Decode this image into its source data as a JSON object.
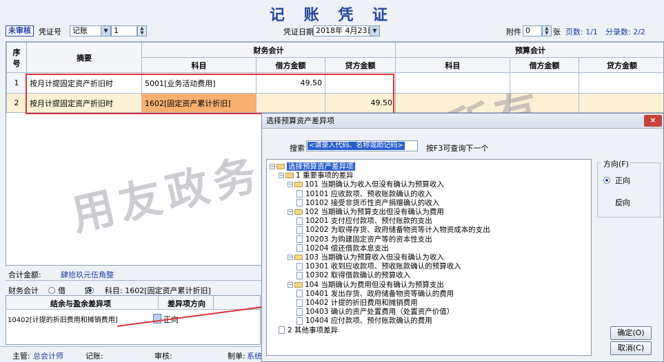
{
  "header": {
    "title": "记 账 凭 证",
    "status_badge": "未审核",
    "voucher_word_label": "凭证号",
    "voucher_word_value": "记账",
    "voucher_number": "1",
    "voucher_date_label": "凭证日期",
    "voucher_date_value": "2018年 4月23日",
    "attachments_label": "附件",
    "attachments_value": "0",
    "attachments_unit": "张",
    "page_label": "页数: 1/1",
    "entries_label": "分录数: 2/2"
  },
  "grid": {
    "col_seq": "序号",
    "col_summary": "摘要",
    "group_financial": "财务会计",
    "group_budget": "预算会计",
    "col_subject": "科目",
    "col_debit": "借方金额",
    "col_credit": "贷方金额",
    "rows": [
      {
        "seq": "1",
        "summary": "按月计提固定资产折旧时",
        "subject": "5001[业务活动费用]",
        "debit": "49.50",
        "credit": ""
      },
      {
        "seq": "2",
        "summary": "按月计提固定资产折旧时",
        "subject": "1602[固定资产累计折旧]",
        "debit": "",
        "credit": "49.50"
      }
    ]
  },
  "totals": {
    "label": "合计金额:",
    "value": "肆拾玖元伍角整"
  },
  "detail": {
    "fin_label": "财务会计",
    "debit_label": "借",
    "credit_label": "贷",
    "subject_text": "科目: 1602[固定资产累计折旧]",
    "col_item": "结余与盈余差异项",
    "col_direction": "差异项方向",
    "item_value": "10402[计提的折旧费用和摊销费用]",
    "direction_value": "正向"
  },
  "footer": {
    "supervisor_label": "主管:",
    "supervisor_value": "总会计师",
    "bookkeeper_label": "记账:",
    "auditor_label": "审核:",
    "maker_label": "制单:",
    "maker_value": "系统"
  },
  "watermark": "用友政务公司版权所有",
  "dialog": {
    "title": "选择预算资产差异项",
    "close": "×",
    "search_label": "搜索",
    "search_placeholder": "<请录入代码、名称或助记码>",
    "search_hint": "按F3可查询下一个",
    "direction_group": "方向(F)",
    "dir_positive": "正向",
    "dir_negative": "反向",
    "ok": "确定(O)",
    "cancel": "取消(C)",
    "tree": [
      {
        "label": "选择预算资产差异项",
        "level": 0
      },
      {
        "label": "1 重要事项的差异",
        "level": 1
      },
      {
        "label": "101 当期确认为收入但没有确认为预算收入",
        "level": 2
      },
      {
        "label": "10101 应收款项、预收账款确认的收入",
        "level": 3
      },
      {
        "label": "10102 接受非货币性资产捐赠确认的收入",
        "level": 3
      },
      {
        "label": "102 当期确认为预算支出但没有确认为费用",
        "level": 2
      },
      {
        "label": "10201 支付应付款项、预付账款的支出",
        "level": 3
      },
      {
        "label": "10202 为取得存货、政府储备物资等计入物资成本的支出",
        "level": 3
      },
      {
        "label": "10203 为购建固定资产等的资本性支出",
        "level": 3
      },
      {
        "label": "10204 偿还借款本息支出",
        "level": 3
      },
      {
        "label": "103 当期确认为预算收入但没有确认为收入",
        "level": 2
      },
      {
        "label": "10301 收到应收款项、预收账款确认的预算收入",
        "level": 3
      },
      {
        "label": "10302 取得借款确认的预算收入",
        "level": 3
      },
      {
        "label": "104 当期确认为费用但没有确认为预算支出",
        "level": 2
      },
      {
        "label": "10401 发出存货、政府储备物资等确认的费用",
        "level": 3
      },
      {
        "label": "10402 计提的折旧费用和摊销费用",
        "level": 3
      },
      {
        "label": "10403 确认的资产处置费用（处置资产价值）",
        "level": 3
      },
      {
        "label": "10404 应付款项、预付账款确认的费用",
        "level": 3
      },
      {
        "label": "2 其他事项差异",
        "level": 1
      }
    ]
  },
  "colors": {
    "accent": "#2447a0",
    "highlight_row": "#fdf1d5",
    "highlight_cell": "#f7b070",
    "annotation_red": "#e0303a"
  }
}
